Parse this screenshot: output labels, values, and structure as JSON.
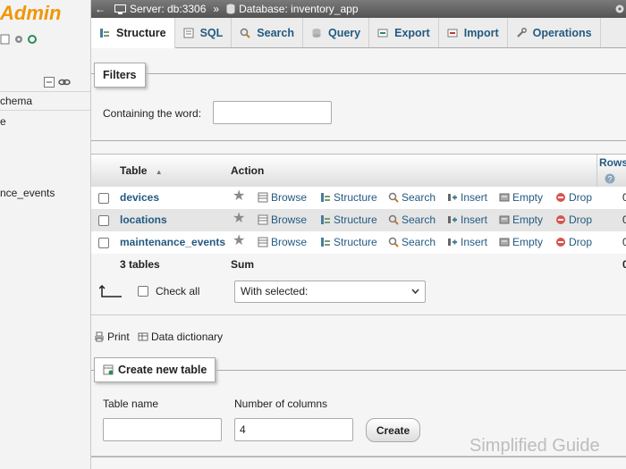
{
  "sidebar": {
    "logo": "Admin",
    "items": [
      "chema",
      "e",
      "nce_events"
    ]
  },
  "topbar": {
    "server": "Server: db:3306",
    "separator": "»",
    "database": "Database: inventory_app"
  },
  "tabs": [
    {
      "label": "Structure",
      "icon": "structure-icon",
      "active": true
    },
    {
      "label": "SQL",
      "icon": "sql-icon"
    },
    {
      "label": "Search",
      "icon": "search-icon"
    },
    {
      "label": "Query",
      "icon": "query-icon"
    },
    {
      "label": "Export",
      "icon": "export-icon"
    },
    {
      "label": "Import",
      "icon": "import-icon"
    },
    {
      "label": "Operations",
      "icon": "wrench-icon"
    }
  ],
  "filters": {
    "legend": "Filters",
    "label": "Containing the word:",
    "value": ""
  },
  "table": {
    "headers": {
      "table": "Table",
      "sort": "▲",
      "action": "Action",
      "rows": "Rows"
    },
    "actions": {
      "browse": "Browse",
      "structure": "Structure",
      "search": "Search",
      "insert": "Insert",
      "empty": "Empty",
      "drop": "Drop"
    },
    "rows": [
      {
        "name": "devices",
        "rows": "0"
      },
      {
        "name": "locations",
        "rows": "0"
      },
      {
        "name": "maintenance_events",
        "rows": "0"
      }
    ],
    "summary": {
      "count": "3 tables",
      "sum": "Sum",
      "rows": "0"
    }
  },
  "bulk": {
    "check_all": "Check all",
    "with_selected": "With selected:"
  },
  "links": {
    "print": "Print",
    "data_dictionary": "Data dictionary"
  },
  "create": {
    "legend": "Create new table",
    "name_label": "Table name",
    "name_value": "",
    "columns_label": "Number of columns",
    "columns_value": "4",
    "button": "Create"
  },
  "watermark": "Simplified Guide",
  "colors": {
    "accent": "#235a81",
    "logo": "#f0960a",
    "drop": "#d9534f"
  }
}
